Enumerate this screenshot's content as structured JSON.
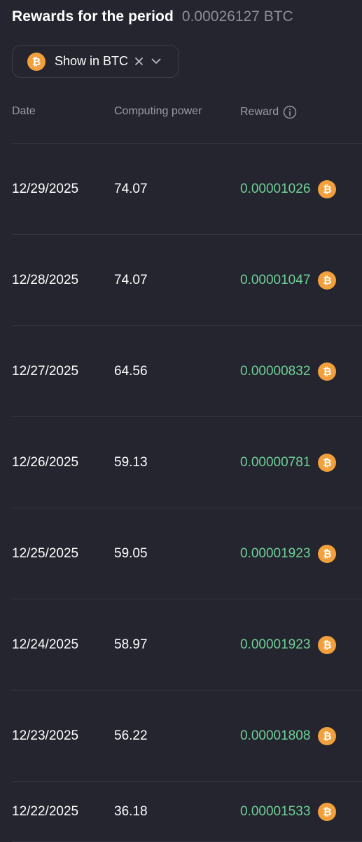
{
  "header": {
    "title": "Rewards for the period",
    "total": "0.00026127 BTC"
  },
  "filter": {
    "label": "Show in BTC",
    "coin_symbol": "₿",
    "icons": [
      "bitcoin-icon",
      "close-icon",
      "chevron-down-icon"
    ]
  },
  "table": {
    "columns": {
      "date": "Date",
      "power": "Computing power",
      "reward": "Reward"
    },
    "rows": [
      {
        "date": "12/29/2025",
        "power": "74.07",
        "reward": "0.00001026"
      },
      {
        "date": "12/28/2025",
        "power": "74.07",
        "reward": "0.00001047"
      },
      {
        "date": "12/27/2025",
        "power": "64.56",
        "reward": "0.00000832"
      },
      {
        "date": "12/26/2025",
        "power": "59.13",
        "reward": "0.00000781"
      },
      {
        "date": "12/25/2025",
        "power": "59.05",
        "reward": "0.00001923"
      },
      {
        "date": "12/24/2025",
        "power": "58.97",
        "reward": "0.00001923"
      },
      {
        "date": "12/23/2025",
        "power": "56.22",
        "reward": "0.00001808"
      },
      {
        "date": "12/22/2025",
        "power": "36.18",
        "reward": "0.00001533"
      }
    ]
  },
  "colors": {
    "background": "#24252f",
    "reward_green": "#6fcf97",
    "bitcoin_orange": "#f2a03d",
    "muted_text": "#9a9ba6"
  }
}
